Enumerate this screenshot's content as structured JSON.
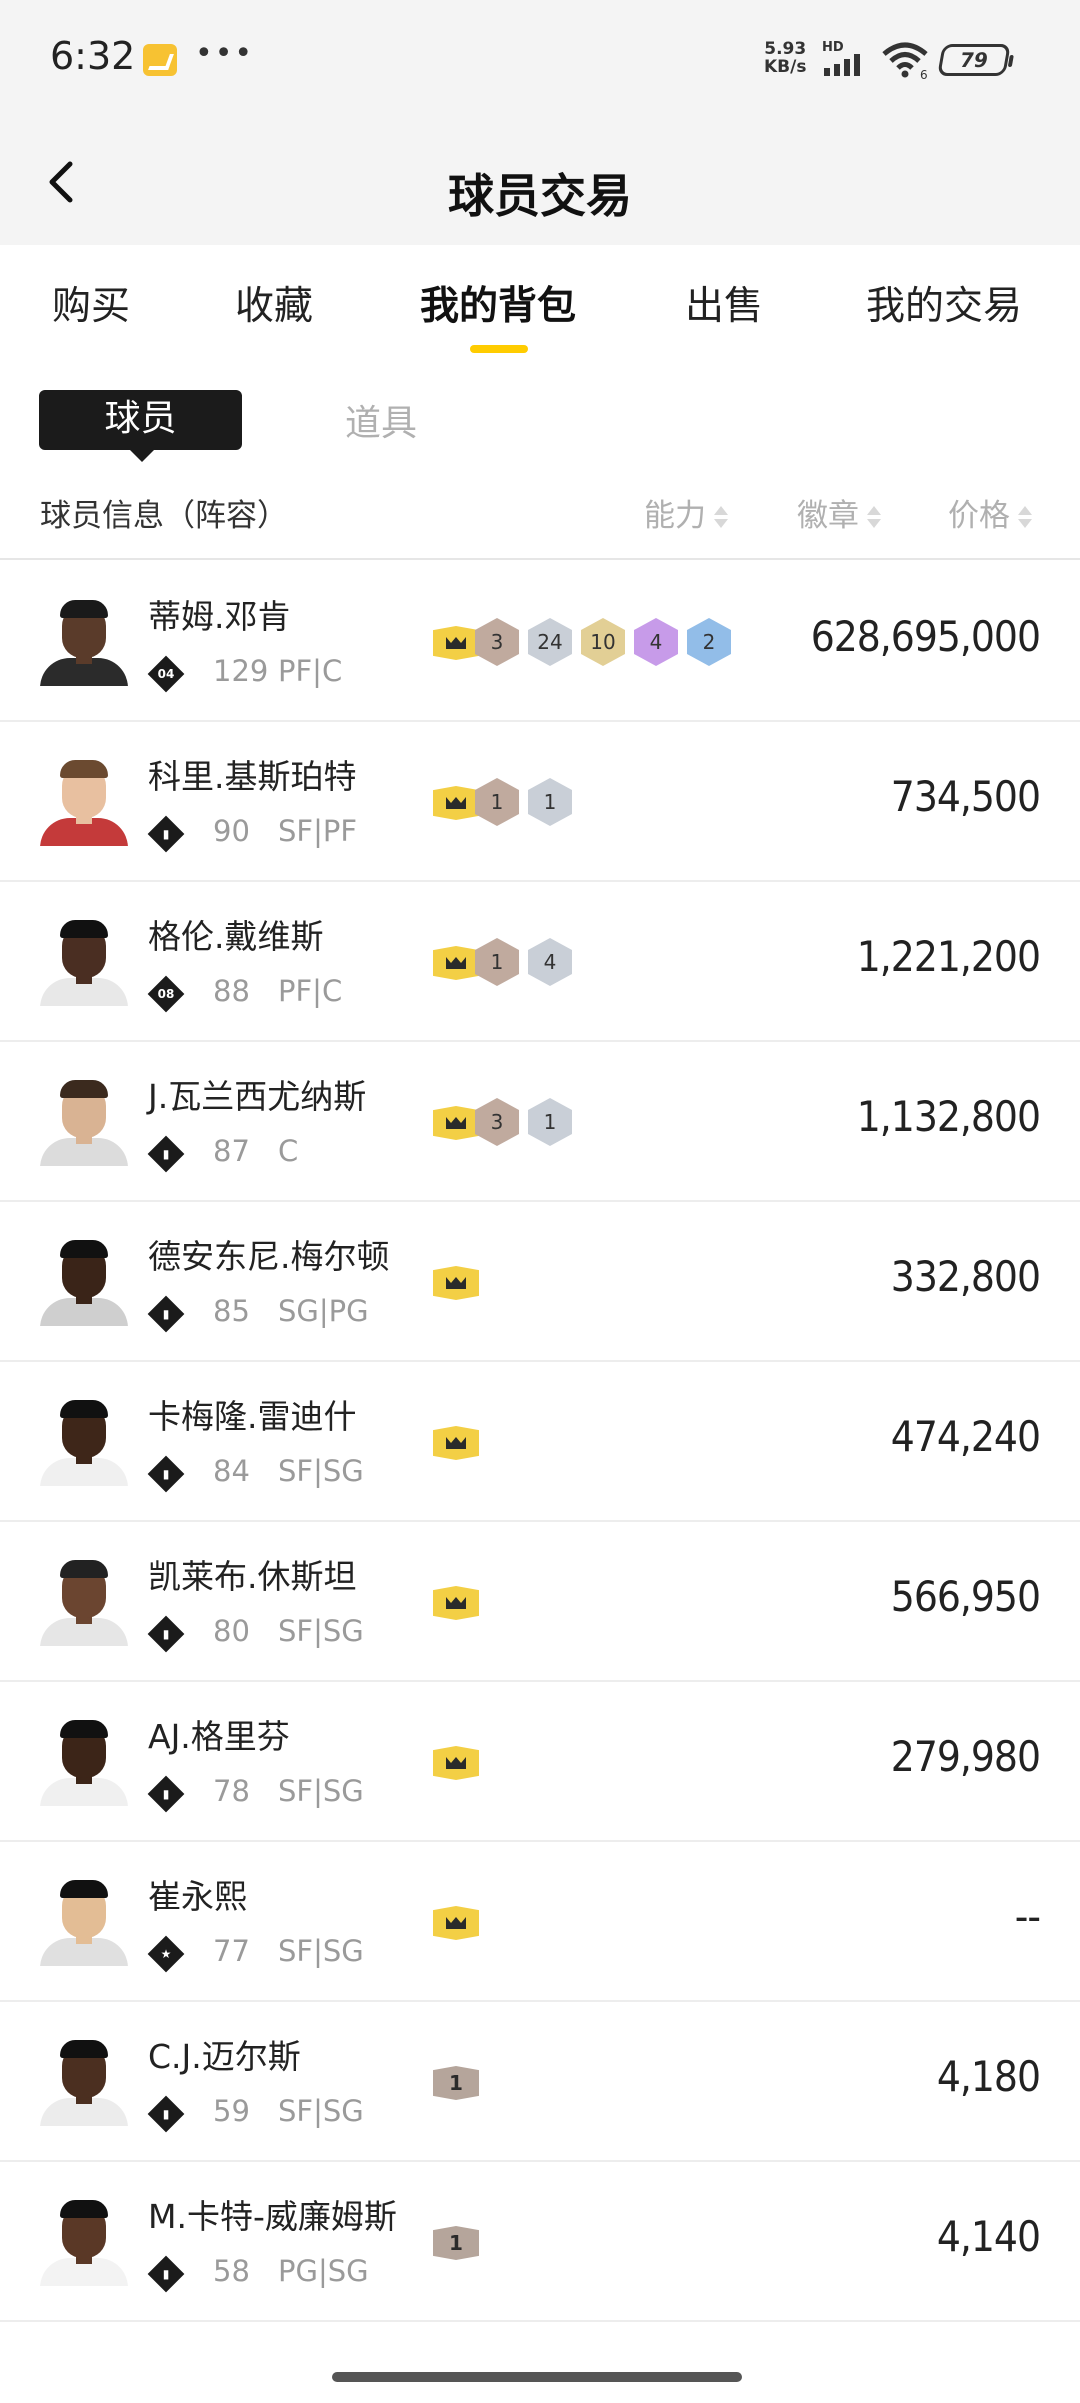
{
  "status_bar": {
    "time": "6:32",
    "speed_top": "5.93",
    "speed_bottom": "KB/s",
    "hd": "HD",
    "wifi_sub": "6",
    "battery": "79"
  },
  "header": {
    "title": "球员交易"
  },
  "tabs": [
    "购买",
    "收藏",
    "我的背包",
    "出售",
    "我的交易"
  ],
  "active_tab": "我的背包",
  "subtabs": {
    "player": "球员",
    "item": "道具"
  },
  "columns": {
    "info": "球员信息（阵容）",
    "ability": "能力",
    "badge": "徽章",
    "price": "价格"
  },
  "players": [
    {
      "name": "蒂姆.邓肯",
      "type": "04",
      "overall": "129",
      "positions": "PF|C",
      "badge": "crown",
      "hex": [
        {
          "v": "3",
          "c": "bronze"
        },
        {
          "v": "24",
          "c": "silver"
        },
        {
          "v": "10",
          "c": "gold"
        },
        {
          "v": "4",
          "c": "purple"
        },
        {
          "v": "2",
          "c": "blue"
        }
      ],
      "price": "628,695,000"
    },
    {
      "name": "科里.基斯珀特",
      "type": "bars",
      "overall": "90",
      "positions": "SF|PF",
      "badge": "crown",
      "hex": [
        {
          "v": "1",
          "c": "bronze"
        },
        {
          "v": "1",
          "c": "silver"
        }
      ],
      "price": "734,500"
    },
    {
      "name": "格伦.戴维斯",
      "type": "08",
      "overall": "88",
      "positions": "PF|C",
      "badge": "crown",
      "hex": [
        {
          "v": "1",
          "c": "bronze"
        },
        {
          "v": "4",
          "c": "silver"
        }
      ],
      "price": "1,221,200"
    },
    {
      "name": "J.瓦兰西尤纳斯",
      "type": "bars",
      "overall": "87",
      "positions": "C",
      "badge": "crown",
      "hex": [
        {
          "v": "3",
          "c": "bronze"
        },
        {
          "v": "1",
          "c": "silver"
        }
      ],
      "price": "1,132,800"
    },
    {
      "name": "德安东尼.梅尔顿",
      "type": "bars",
      "overall": "85",
      "positions": "SG|PG",
      "badge": "crown",
      "hex": [],
      "price": "332,800"
    },
    {
      "name": "卡梅隆.雷迪什",
      "type": "bars",
      "overall": "84",
      "positions": "SF|SG",
      "badge": "crown",
      "hex": [],
      "price": "474,240"
    },
    {
      "name": "凯莱布.休斯坦",
      "type": "bars",
      "overall": "80",
      "positions": "SF|SG",
      "badge": "crown",
      "hex": [],
      "price": "566,950"
    },
    {
      "name": "AJ.格里芬",
      "type": "bars",
      "overall": "78",
      "positions": "SF|SG",
      "badge": "crown",
      "hex": [],
      "price": "279,980"
    },
    {
      "name": "崔永熙",
      "type": "star",
      "overall": "77",
      "positions": "SF|SG",
      "badge": "crown",
      "hex": [],
      "price": "--"
    },
    {
      "name": "C.J.迈尔斯",
      "type": "bars",
      "overall": "59",
      "positions": "SF|SG",
      "badge": "1",
      "hex": [],
      "price": "4,180"
    },
    {
      "name": "M.卡特-威廉姆斯",
      "type": "bars",
      "overall": "58",
      "positions": "PG|SG",
      "badge": "1",
      "hex": [],
      "price": "4,140"
    }
  ],
  "icons": {
    "back": "chevron-left-icon",
    "crown": "crown-icon",
    "sort": "sort-arrows-icon"
  },
  "colors": {
    "accent": "#ffcc00",
    "crown_badge": "#f3cf45",
    "dark_pill": "#1b1b1b"
  }
}
